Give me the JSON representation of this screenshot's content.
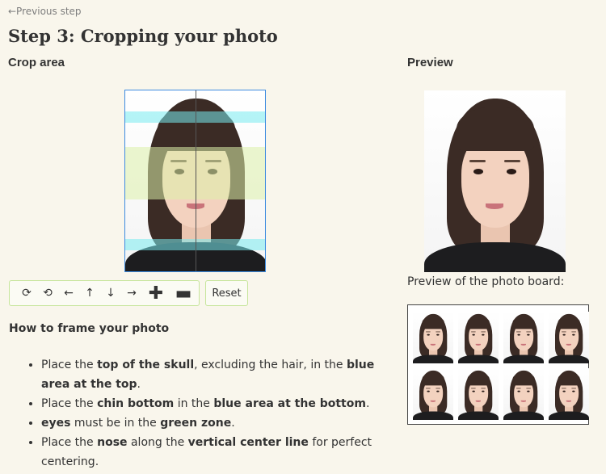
{
  "nav": {
    "back_label": "←Previous step"
  },
  "page": {
    "title": "Step 3: Cropping your photo"
  },
  "crop": {
    "label": "Crop area",
    "toolbar": {
      "rotate_right": "⟳",
      "rotate_left": "⟲",
      "move_left": "←",
      "move_up": "↑",
      "move_down": "↓",
      "move_right": "→",
      "zoom_in": "✚",
      "zoom_out": "▬"
    },
    "reset_label": "Reset"
  },
  "preview": {
    "label": "Preview",
    "board_label": "Preview of the photo board:",
    "board_count": 8
  },
  "instructions": {
    "heading": "How to frame your photo",
    "items": [
      [
        {
          "t": "Place the "
        },
        {
          "t": "top of the skull",
          "b": true
        },
        {
          "t": ", excluding the hair, in the "
        },
        {
          "t": "blue area at the top",
          "b": true
        },
        {
          "t": "."
        }
      ],
      [
        {
          "t": "Place the "
        },
        {
          "t": "chin bottom",
          "b": true
        },
        {
          "t": " in the "
        },
        {
          "t": "blue area at the bottom",
          "b": true
        },
        {
          "t": "."
        }
      ],
      [
        {
          "t": "eyes",
          "b": true
        },
        {
          "t": " must be in the "
        },
        {
          "t": "green zone",
          "b": true
        },
        {
          "t": "."
        }
      ],
      [
        {
          "t": "Place the "
        },
        {
          "t": "nose",
          "b": true
        },
        {
          "t": " along the "
        },
        {
          "t": "vertical center line",
          "b": true
        },
        {
          "t": " for perfect centering."
        }
      ]
    ]
  },
  "colors": {
    "background": "#f9f6ec",
    "guide_blue": "#78ebf0",
    "guide_green": "#dcf0aa",
    "crop_border": "#3d8be0",
    "toolbar_border": "#c6e59b"
  }
}
